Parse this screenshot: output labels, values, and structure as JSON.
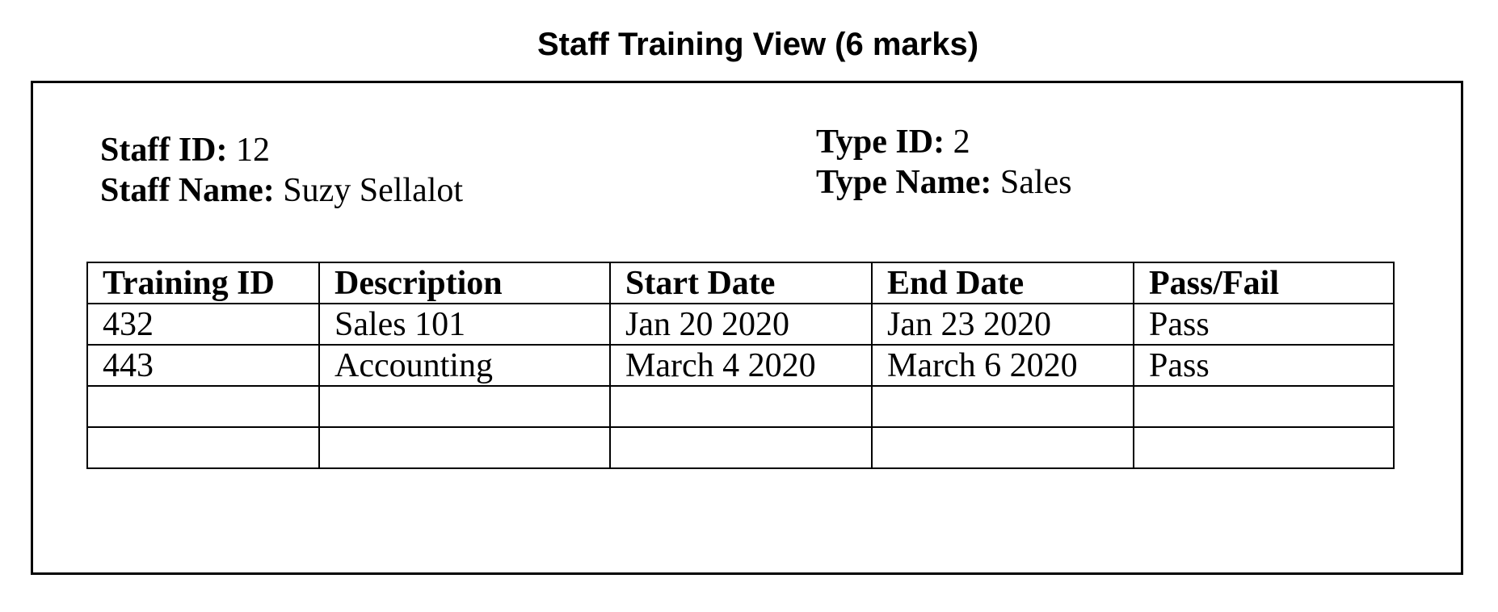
{
  "title": "Staff Training View (6 marks)",
  "staff": {
    "id_label": "Staff ID:",
    "id_value": "12",
    "name_label": "Staff Name:",
    "name_value": "Suzy Sellalot"
  },
  "type": {
    "id_label": "Type ID:",
    "id_value": "2",
    "name_label": "Type Name:",
    "name_value": "Sales"
  },
  "table": {
    "headers": [
      "Training ID",
      "Description",
      "Start Date",
      "End Date",
      "Pass/Fail"
    ],
    "rows": [
      [
        "432",
        "Sales 101",
        "Jan 20 2020",
        "Jan 23 2020",
        "Pass"
      ],
      [
        "443",
        "Accounting",
        "March 4 2020",
        "March 6 2020",
        "Pass"
      ],
      [
        "",
        "",
        "",
        "",
        ""
      ],
      [
        "",
        "",
        "",
        "",
        ""
      ]
    ]
  }
}
